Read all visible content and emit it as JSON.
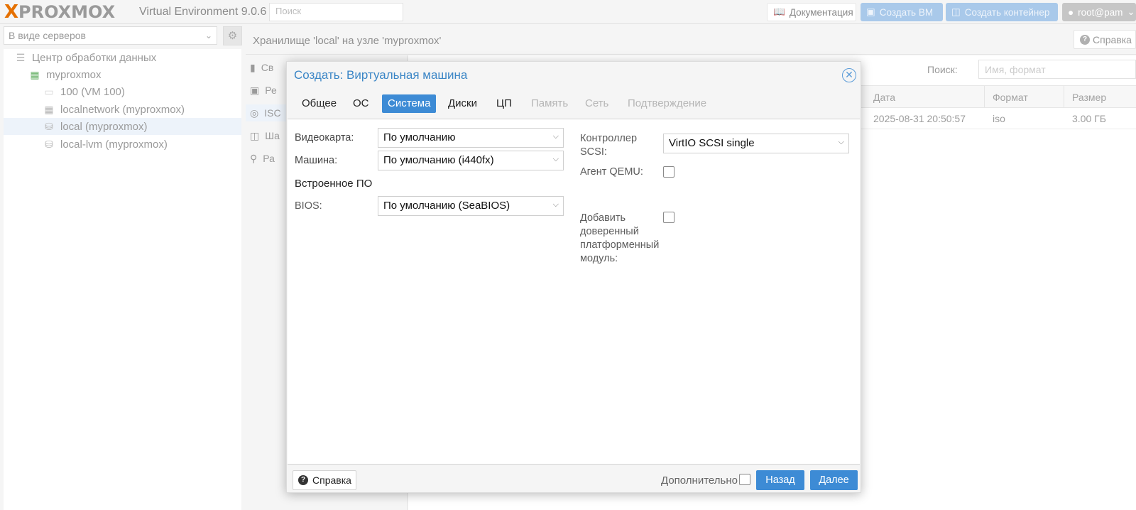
{
  "app": {
    "logo_x": "X",
    "logo_text": "PROXMOX",
    "version": "Virtual Environment 9.0.6",
    "search_placeholder": "Поиск",
    "btn_docs": "Документация",
    "btn_create_vm": "Создать ВМ",
    "btn_create_ct": "Создать контейнер",
    "user": "root@pam"
  },
  "sidebar": {
    "view": "В виде серверов",
    "tree": [
      {
        "label": "Центр обработки данных",
        "icon": "datacenter-icon"
      },
      {
        "label": "myproxmox",
        "icon": "node-online-icon"
      },
      {
        "label": "100 (VM 100)",
        "icon": "vm-icon"
      },
      {
        "label": "localnetwork (myproxmox)",
        "icon": "network-icon"
      },
      {
        "label": "local (myproxmox)",
        "icon": "storage-icon"
      },
      {
        "label": "local-lvm (myproxmox)",
        "icon": "storage-icon"
      }
    ]
  },
  "main": {
    "breadcrumb": "Хранилище 'local' на узле 'myproxmox'",
    "help": "Справка",
    "subnav": [
      "Св",
      "Ре",
      "ISC",
      "Ша",
      "Ра"
    ],
    "search_label": "Поиск:",
    "search_placeholder": "Имя, формат",
    "columns": [
      "Дата",
      "Формат",
      "Размер"
    ],
    "rows": [
      {
        "date": "2025-08-31 20:50:57",
        "format": "iso",
        "size": "3.00 ГБ"
      }
    ]
  },
  "dialog": {
    "title": "Создать: Виртуальная машина",
    "tabs": [
      "Общее",
      "ОС",
      "Система",
      "Диски",
      "ЦП",
      "Память",
      "Сеть",
      "Подтверждение"
    ],
    "active_tab": "Система",
    "left": {
      "gpu_label": "Видеокарта:",
      "gpu_value": "По умолчанию",
      "machine_label": "Машина:",
      "machine_value": "По умолчанию (i440fx)",
      "firmware_section": "Встроенное ПО",
      "bios_label": "BIOS:",
      "bios_value": "По умолчанию (SeaBIOS)"
    },
    "right": {
      "scsi_label_1": "Контроллер",
      "scsi_label_2": "SCSI:",
      "scsi_value": "VirtIO SCSI single",
      "qemu_label": "Агент QEMU:",
      "qemu_checked": false,
      "tpm_label_1": "Добавить",
      "tpm_label_2": "доверенный",
      "tpm_label_3": "платформенный",
      "tpm_label_4": "модуль:",
      "tpm_checked": false
    },
    "footer": {
      "help": "Справка",
      "advanced": "Дополнительно",
      "advanced_checked": false,
      "back": "Назад",
      "next": "Далее"
    }
  },
  "colors": {
    "accent": "#3d8bd5",
    "title": "#3b86c6",
    "logo_orange": "#e57000"
  }
}
